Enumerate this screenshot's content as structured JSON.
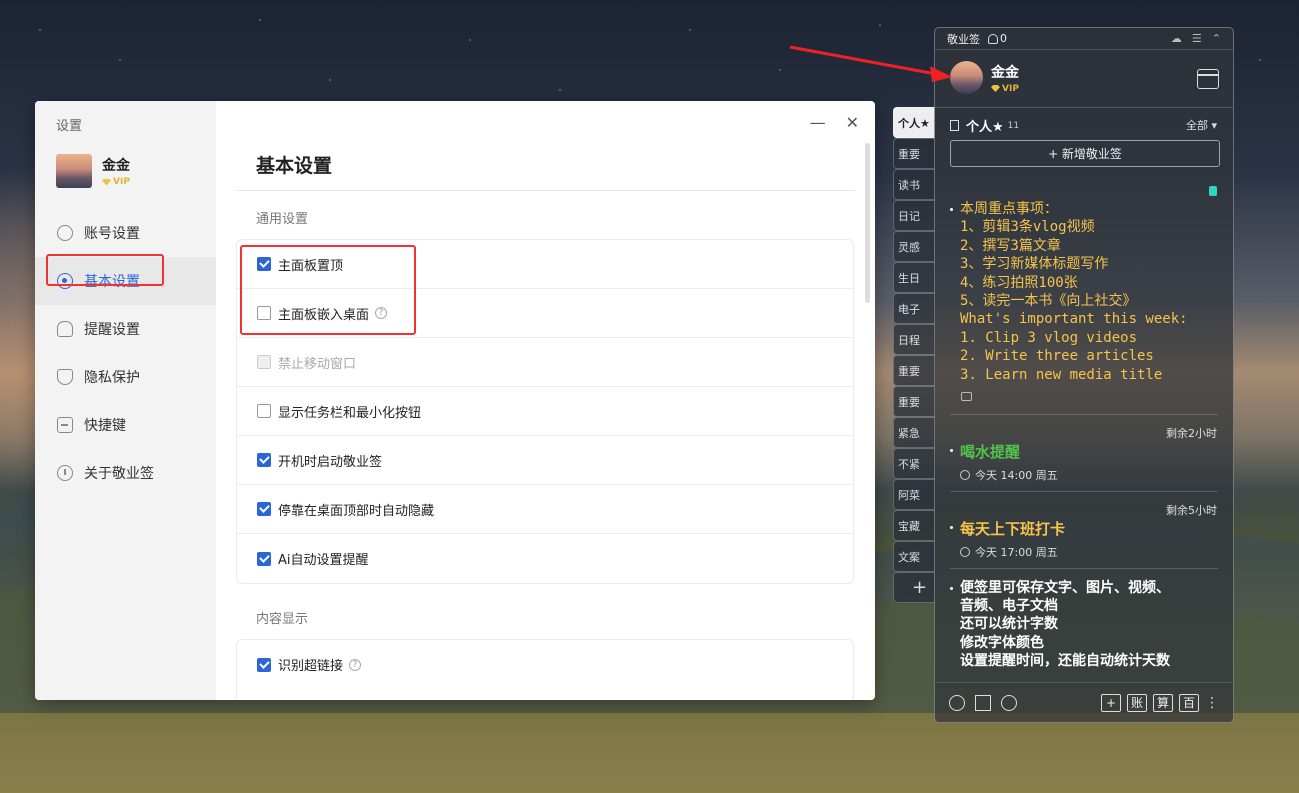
{
  "settings": {
    "window_title": "设置",
    "user": {
      "name": "金金",
      "vip": "VIP"
    },
    "nav": [
      {
        "label": "账号设置",
        "icon": "user-icon"
      },
      {
        "label": "基本设置",
        "icon": "settings-dot-icon",
        "active": true
      },
      {
        "label": "提醒设置",
        "icon": "bell-icon"
      },
      {
        "label": "隐私保护",
        "icon": "shield-icon"
      },
      {
        "label": "快捷键",
        "icon": "keyboard-icon"
      },
      {
        "label": "关于敬业签",
        "icon": "info-icon"
      }
    ],
    "minimize": "—",
    "close": "✕",
    "page_title": "基本设置",
    "general": {
      "label": "通用设置",
      "rows": [
        {
          "label": "主面板置顶",
          "checked": true
        },
        {
          "label": "主面板嵌入桌面",
          "checked": false,
          "help": "?"
        },
        {
          "label": "禁止移动窗口",
          "checked": false,
          "disabled": true
        },
        {
          "label": "显示任务栏和最小化按钮",
          "checked": false
        },
        {
          "label": "开机时启动敬业签",
          "checked": true
        },
        {
          "label": "停靠在桌面顶部时自动隐藏",
          "checked": true
        },
        {
          "label": "Ai自动设置提醒",
          "checked": true
        }
      ]
    },
    "content": {
      "label": "内容显示",
      "rows": [
        {
          "label": "识别超链接",
          "checked": true,
          "help": "?"
        }
      ]
    }
  },
  "tabs": [
    "个人★",
    "重要",
    "读书",
    "日记",
    "灵感",
    "生日",
    "电子",
    "日程",
    "重要",
    "重要",
    "紧急",
    "不紧",
    "阿菜",
    "宝藏",
    "文案",
    "+"
  ],
  "note": {
    "app_name": "敬业签",
    "bell_count": "0",
    "user": {
      "name": "金金",
      "vip": "VIP"
    },
    "category": {
      "name": "个人★",
      "count": "11"
    },
    "filter": "全部 ▾",
    "add_button": "+ 新增敬业签",
    "items": [
      {
        "text": "本周重点事项：\n1、剪辑3条vlog视频\n2、撰写3篇文章\n3、学习新媒体标题写作\n4、练习拍照100张\n5、读完一本书《向上社交》\nWhat's important this week:\n1. Clip 3 vlog videos\n2. Write three articles\n3. Learn new media title"
      }
    ],
    "reminders": [
      {
        "remain": "剩余2小时",
        "title": "喝水提醒",
        "meta": "今天  14:00  周五",
        "color": "#52c24a"
      },
      {
        "remain": "剩余5小时",
        "title": "每天上下班打卡",
        "meta": "今天  17:00  周五",
        "color": "#f5c44a"
      }
    ],
    "last_note": "便签里可保存文字、图片、视频、\n音频、电子文档\n还可以统计字数\n修改字体颜色\n设置提醒时间，还能自动统计天数",
    "bottom": [
      "+",
      "账",
      "算",
      "百",
      "⋮"
    ]
  },
  "colors": {
    "accent": "#2a66d8",
    "highlight_box": "#e33333",
    "note_yellow": "#f5c44a",
    "note_green": "#52c24a"
  }
}
